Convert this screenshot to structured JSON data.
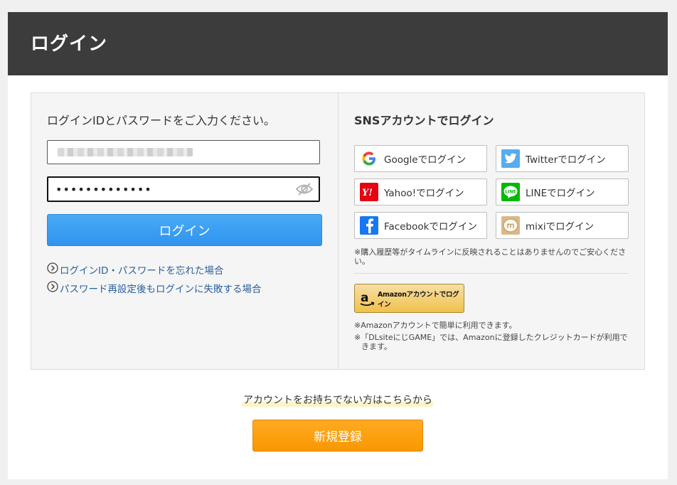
{
  "header": {
    "title": "ログイン"
  },
  "login": {
    "instruction": "ログインIDとパスワードをご入力ください。",
    "id_value": "",
    "password_value": "•••••••••••••",
    "login_button": "ログイン",
    "forgot_link": "ログインID・パスワードを忘れた場合",
    "reset_fail_link": "パスワード再設定後もログインに失敗する場合"
  },
  "sns": {
    "title": "SNSアカウントでログイン",
    "google": "Googleでログイン",
    "twitter": "Twitterでログイン",
    "yahoo": "Yahoo!でログイン",
    "line": "LINEでログイン",
    "facebook": "Facebookでログイン",
    "mixi": "mixiでログイン",
    "note": "※購入履歴等がタイムラインに反映されることはありませんのでご安心ください。"
  },
  "amazon": {
    "button_label": "Amazonアカウントでログイン",
    "note1": "※Amazonアカウントで簡単に利用できます。",
    "note2_line1": "※「DLsiteにじGAME」では、Amazonに登録したクレジットカードが利用で",
    "note2_line2": "きます。"
  },
  "signup": {
    "prompt": "アカウントをお持ちでない方はこちらから",
    "button": "新規登録"
  },
  "colors": {
    "header_bg": "#3c3c3c",
    "login_button": "#3a9cf2",
    "signup_button": "#f99800",
    "link": "#2a5fa0"
  },
  "icons": {
    "password_toggle": "eye-icon",
    "link_bullet": "circle-arrow-icon"
  }
}
